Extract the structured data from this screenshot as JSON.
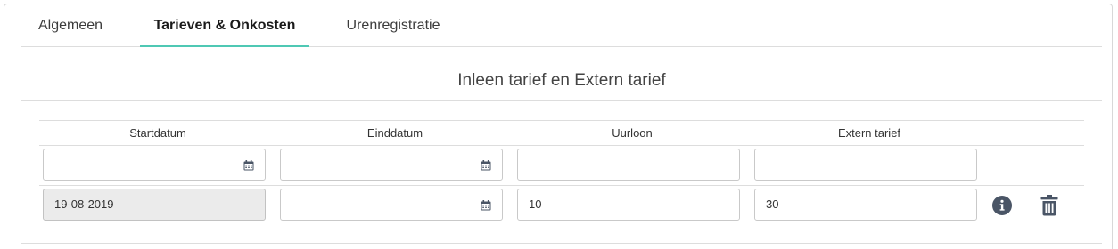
{
  "tabs": [
    {
      "label": "Algemeen",
      "active": false
    },
    {
      "label": "Tarieven & Onkosten",
      "active": true
    },
    {
      "label": "Urenregistratie",
      "active": false
    }
  ],
  "section": {
    "title": "Inleen tarief en Extern tarief"
  },
  "table": {
    "headers": [
      "Startdatum",
      "Einddatum",
      "Uurloon",
      "Extern tarief"
    ],
    "rows": [
      {
        "start": "",
        "end": "",
        "uurloon": "",
        "extern": ""
      },
      {
        "start": "19-08-2019",
        "end": "",
        "uurloon": "10",
        "extern": "30"
      }
    ]
  },
  "icons": {
    "calendar": "calendar-icon",
    "info": "info-icon",
    "delete": "trash-icon"
  },
  "colors": {
    "accent": "#4fc8b4",
    "icon": "#4a5566",
    "readonly_bg": "#ebebeb"
  }
}
